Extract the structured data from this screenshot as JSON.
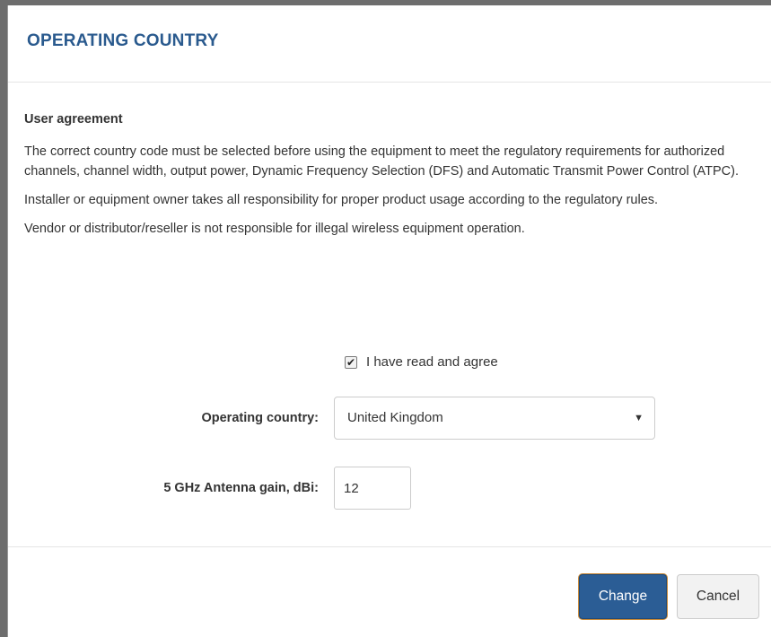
{
  "dialog": {
    "title": "OPERATING COUNTRY"
  },
  "body": {
    "section_title": "User agreement",
    "paragraphs": [
      "The correct country code must be selected before using the equipment to meet the regulatory requirements for authorized channels, channel width, output power, Dynamic Frequency Selection (DFS) and Automatic Transmit Power Control (ATPC).",
      "Installer or equipment owner takes all responsibility for proper product usage according to the regulatory rules.",
      "Vendor or distributor/reseller is not responsible for illegal wireless equipment operation."
    ],
    "agree": {
      "label": "I have read and agree",
      "checked": true,
      "check_glyph": "✔"
    }
  },
  "form": {
    "country_label": "Operating country:",
    "country_value": "United Kingdom",
    "caret_glyph": "▼",
    "gain_label": "5 GHz Antenna gain, dBi:",
    "gain_value": "12"
  },
  "footer": {
    "change_label": "Change",
    "cancel_label": "Cancel"
  },
  "colors": {
    "title": "#2a5a8e",
    "primary_button": "#2b5d95",
    "primary_button_focus_ring": "#c88a3a",
    "text": "#333333"
  }
}
